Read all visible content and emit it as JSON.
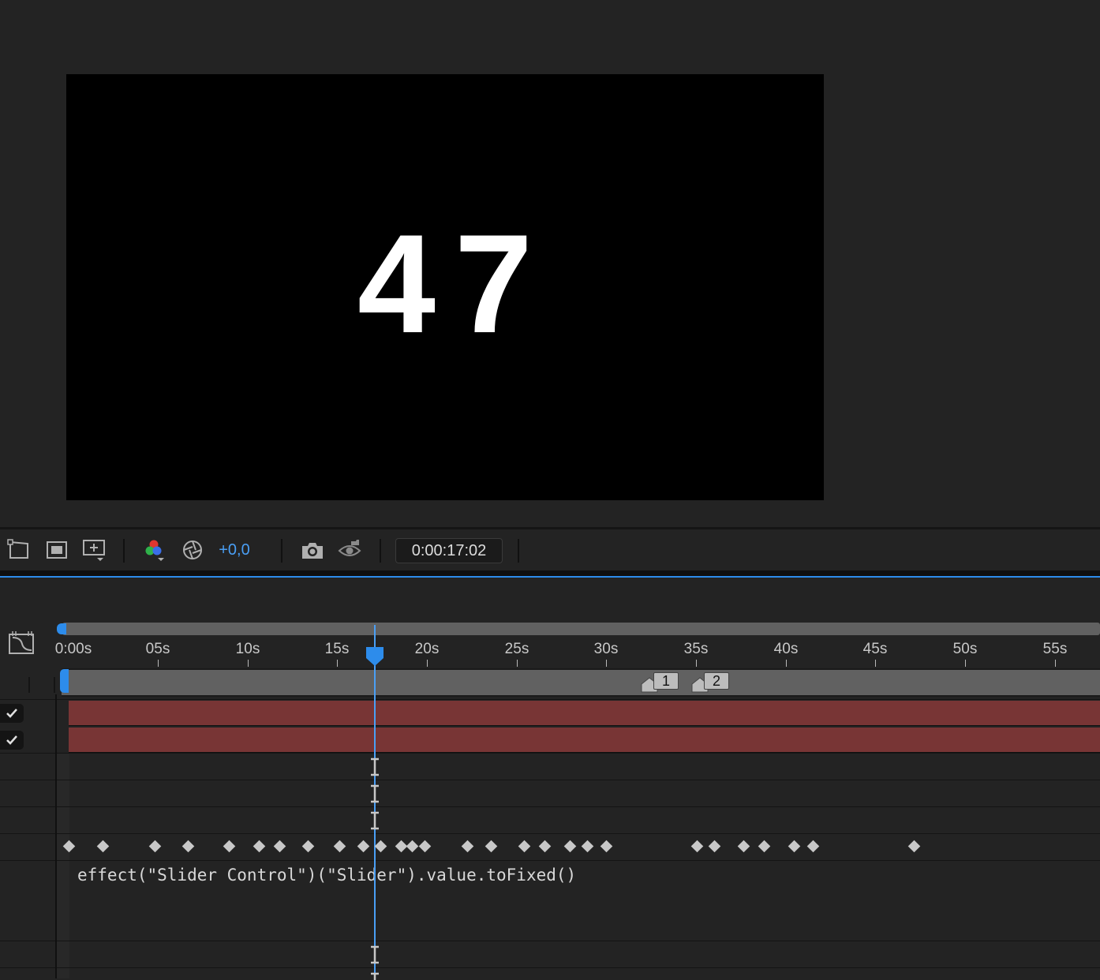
{
  "composition": {
    "display_text": "47"
  },
  "toolbar": {
    "exposure": "+0,0",
    "timecode": "0:00:17:02"
  },
  "timeline": {
    "ruler_labels": [
      "0:00s",
      "05s",
      "10s",
      "15s",
      "20s",
      "25s",
      "30s",
      "35s",
      "40s",
      "45s",
      "50s",
      "55s"
    ],
    "markers": [
      "1",
      "2"
    ],
    "expression": "effect(\"Slider Control\")(\"Slider\").value.toFixed()"
  },
  "colors": {
    "accent": "#2d8ceb",
    "layer_bar": "#783535",
    "background": "#232323"
  }
}
